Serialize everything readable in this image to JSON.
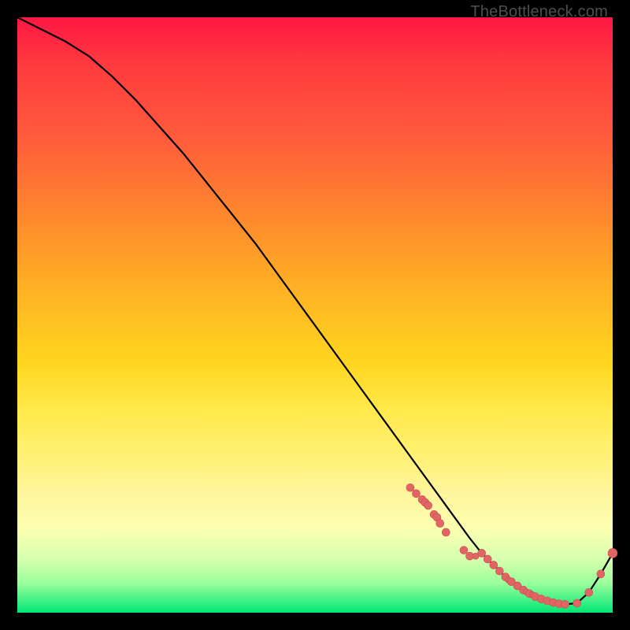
{
  "watermark": "TheBottleneck.com",
  "colors": {
    "curve": "#000000",
    "marker_fill": "#e06666",
    "marker_stroke": "#cc4b4b",
    "background_black": "#000000"
  },
  "chart_data": {
    "type": "line",
    "title": "",
    "xlabel": "",
    "ylabel": "",
    "xlim": [
      0,
      100
    ],
    "ylim": [
      0,
      100
    ],
    "grid": false,
    "legend": false,
    "series": [
      {
        "name": "bottleneck-curve",
        "x": [
          0,
          4,
          8,
          12,
          16,
          20,
          24,
          28,
          32,
          36,
          40,
          44,
          48,
          52,
          56,
          60,
          64,
          68,
          72,
          76,
          78,
          80,
          82,
          84,
          86,
          88,
          90,
          92,
          94,
          96,
          98,
          100
        ],
        "y": [
          100,
          98,
          96,
          93.5,
          90,
          86,
          81.5,
          77,
          72,
          67,
          62,
          56.5,
          51,
          45.5,
          40,
          34.5,
          29,
          23.5,
          18,
          12.5,
          10,
          8,
          6,
          4.5,
          3.2,
          2.3,
          1.7,
          1.4,
          1.6,
          3.4,
          6.5,
          10
        ]
      }
    ],
    "markers_dense": {
      "comment": "cluster of salmon dots along the curve near the trough",
      "x": [
        66,
        67,
        68,
        68.5,
        69,
        70,
        70.5,
        71,
        72,
        75,
        76,
        77,
        78,
        79,
        80,
        81,
        82,
        82.5,
        83,
        84,
        85,
        85.5,
        86,
        86.5,
        87,
        88,
        89,
        90,
        91,
        92,
        94,
        96,
        98,
        100
      ],
      "y": [
        21,
        20,
        19,
        18.5,
        18,
        16.5,
        16,
        15,
        13.5,
        10.5,
        9.5,
        9.5,
        10,
        9,
        8,
        7,
        6,
        5.5,
        5.2,
        4.5,
        3.8,
        3.5,
        3.2,
        3.0,
        2.7,
        2.3,
        2.0,
        1.7,
        1.5,
        1.4,
        1.6,
        3.4,
        6.5,
        10
      ],
      "r": [
        5,
        5,
        5,
        5,
        5,
        5,
        5,
        5,
        5,
        5,
        5,
        4,
        5,
        5,
        5,
        5,
        5,
        4,
        5,
        5,
        5,
        4,
        5,
        4,
        5,
        5,
        5,
        5,
        5,
        5,
        5,
        5,
        5,
        6
      ]
    }
  }
}
